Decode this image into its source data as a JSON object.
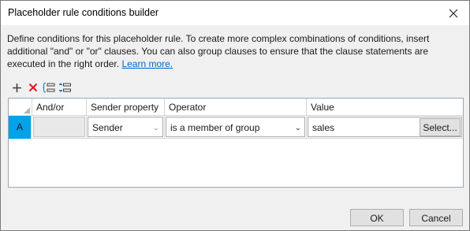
{
  "dialog": {
    "title": "Placeholder rule conditions builder"
  },
  "description": {
    "text": "Define conditions for this placeholder rule. To create more complex combinations of conditions, insert additional \"and\" or \"or\" clauses. You can also group clauses to ensure that the clause statements are executed in the right order. ",
    "link_label": "Learn more."
  },
  "toolbar": {
    "add_icon": "plus-icon",
    "delete_icon": "delete-x-icon",
    "group_icon": "group-clauses-icon",
    "move_icon": "move-clause-icon"
  },
  "grid": {
    "columns": [
      "And/or",
      "Sender property",
      "Operator",
      "Value"
    ],
    "rows": [
      {
        "row_label": "A",
        "and_or": "",
        "sender_property": "Sender",
        "operator": "is a member of group",
        "value": "sales",
        "select_label": "Select..."
      }
    ]
  },
  "buttons": {
    "ok": "OK",
    "cancel": "Cancel"
  },
  "colors": {
    "selected_row_header": "#00a2e8",
    "link": "#0066cc",
    "delete_icon": "#e81123",
    "toolbar_icon": "#1e73be"
  }
}
